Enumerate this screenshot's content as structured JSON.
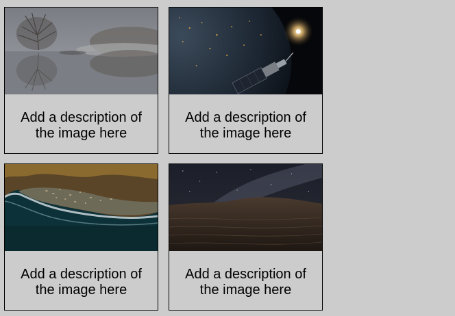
{
  "gallery": {
    "cards": [
      {
        "image": "misty-lake-trees-photo",
        "description": "Add a description of the image here"
      },
      {
        "image": "satellite-orbiting-earth-photo",
        "description": "Add a description of the image here"
      },
      {
        "image": "coastal-town-aerial-photo",
        "description": "Add a description of the image here"
      },
      {
        "image": "desert-dunes-milky-way-photo",
        "description": "Add a description of the image here"
      }
    ]
  }
}
